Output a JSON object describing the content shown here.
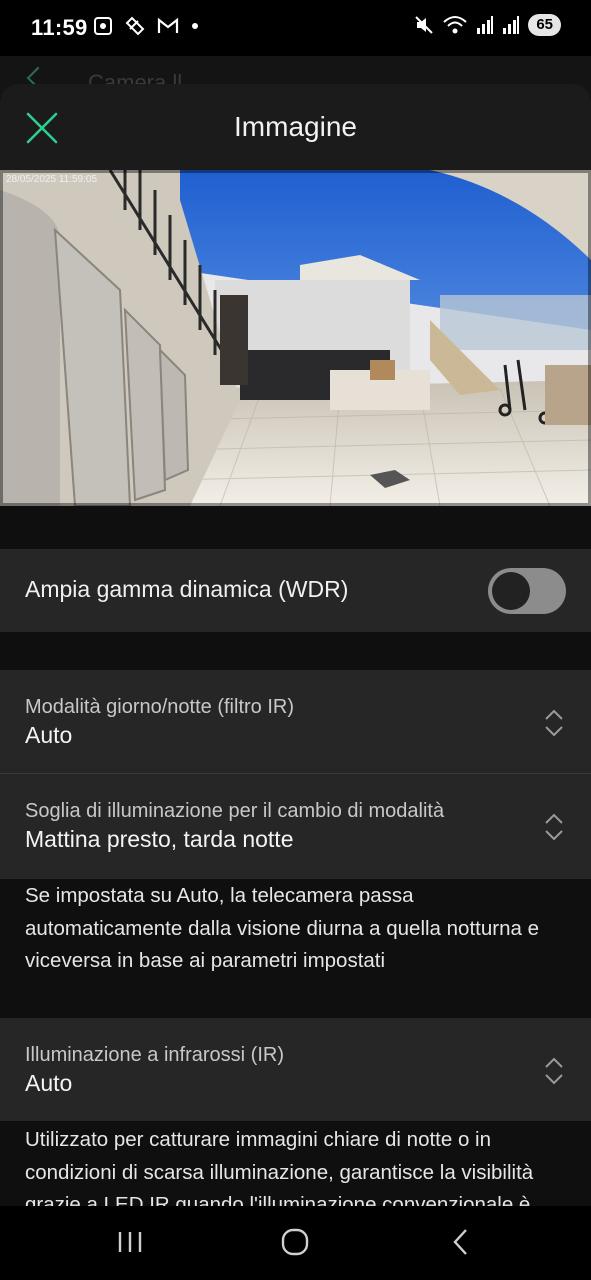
{
  "status_bar": {
    "time": "11:59",
    "battery": "65"
  },
  "behind": {
    "title": "Camera ll"
  },
  "sheet": {
    "title": "Immagine",
    "preview_timestamp": "28/05/2025 11:59:05"
  },
  "wdr": {
    "label": "Ampia gamma dinamica (WDR)",
    "enabled": false
  },
  "day_night_mode": {
    "label": "Modalità giorno/notte (filtro IR)",
    "value": "Auto"
  },
  "light_threshold": {
    "label": "Soglia di illuminazione per il cambio di modalità",
    "value": "Mattina presto, tarda notte",
    "description": "Se impostata su Auto, la telecamera passa automaticamente dalla visione diurna a quella notturna e viceversa in base ai parametri impostati"
  },
  "infrared": {
    "label": "Illuminazione a infrarossi (IR)",
    "value": "Auto",
    "description": "Utilizzato per catturare immagini chiare di notte o in condizioni di scarsa illuminazione, garantisce la visibilità grazie a LED IR quando l'illuminazione convenzionale è"
  },
  "colors": {
    "accent": "#2ecc8f",
    "row_bg": "#262626",
    "background": "#0f0f0f"
  }
}
